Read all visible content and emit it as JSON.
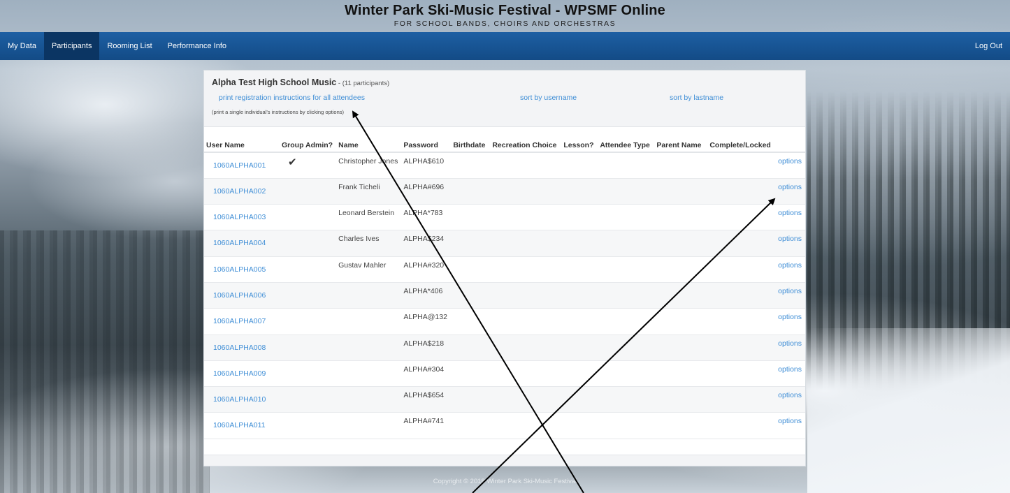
{
  "header": {
    "title": "Winter Park Ski-Music Festival - WPSMF Online",
    "subtitle": "FOR SCHOOL BANDS, CHOIRS AND ORCHESTRAS"
  },
  "nav": {
    "items": [
      "My Data",
      "Participants",
      "Rooming List",
      "Performance Info"
    ],
    "active": "Participants",
    "logout": "Log Out"
  },
  "card": {
    "school": "Alpha Test High School Music",
    "count": " - (11 participants)",
    "print_link": "print registration instructions for all attendees",
    "sort_username": "sort by username",
    "sort_lastname": "sort by lastname",
    "hint": "(print a single individual's instructions by clicking options)"
  },
  "table": {
    "headers": [
      "User Name",
      "Group Admin?",
      "Name",
      "Password",
      "Birthdate",
      "Recreation Choice",
      "Lesson?",
      "Attendee Type",
      "Parent Name",
      "Complete/Locked"
    ],
    "options_label": "options",
    "check_glyph": "✔",
    "rows": [
      {
        "user": "1060ALPHA001",
        "admin": true,
        "name": "Christopher Jones",
        "password": "ALPHA$610"
      },
      {
        "user": "1060ALPHA002",
        "admin": false,
        "name": "Frank Ticheli",
        "password": "ALPHA#696"
      },
      {
        "user": "1060ALPHA003",
        "admin": false,
        "name": "Leonard Berstein",
        "password": "ALPHA*783"
      },
      {
        "user": "1060ALPHA004",
        "admin": false,
        "name": "Charles Ives",
        "password": "ALPHA$234"
      },
      {
        "user": "1060ALPHA005",
        "admin": false,
        "name": "Gustav Mahler",
        "password": "ALPHA#320"
      },
      {
        "user": "1060ALPHA006",
        "admin": false,
        "name": "",
        "password": "ALPHA*406"
      },
      {
        "user": "1060ALPHA007",
        "admin": false,
        "name": "",
        "password": "ALPHA@132"
      },
      {
        "user": "1060ALPHA008",
        "admin": false,
        "name": "",
        "password": "ALPHA$218"
      },
      {
        "user": "1060ALPHA009",
        "admin": false,
        "name": "",
        "password": "ALPHA#304"
      },
      {
        "user": "1060ALPHA010",
        "admin": false,
        "name": "",
        "password": "ALPHA$654"
      },
      {
        "user": "1060ALPHA011",
        "admin": false,
        "name": "",
        "password": "ALPHA#741"
      }
    ]
  },
  "footer": {
    "copyright": "Copyright © 2018 Winter Park Ski-Music Festival"
  }
}
